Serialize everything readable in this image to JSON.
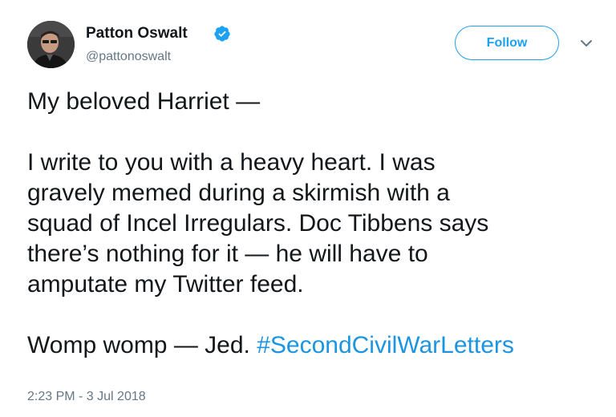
{
  "author": {
    "display_name": "Patton Oswalt",
    "handle": "@pattonoswalt",
    "verified_icon": "verified-badge-icon",
    "avatar_icon": "profile-photo"
  },
  "actions": {
    "follow_label": "Follow",
    "more_icon": "chevron-down-icon"
  },
  "tweet": {
    "greeting": "My beloved Harriet —",
    "body_lines": [
      "I write to you with a heavy heart. I was",
      "gravely memed during a skirmish with a",
      "squad of Incel Irregulars. Doc Tibbens says",
      "there’s nothing for it — he will have to",
      "amputate my Twitter feed."
    ],
    "closing": "Womp womp — Jed. ",
    "hashtag": "#SecondCivilWarLetters"
  },
  "timestamp": "2:23 PM - 3 Jul 2018",
  "colors": {
    "accent": "#1da1f2",
    "hashtag": "#1b95e0",
    "secondary_text": "#657786",
    "primary_text": "#14171a"
  }
}
